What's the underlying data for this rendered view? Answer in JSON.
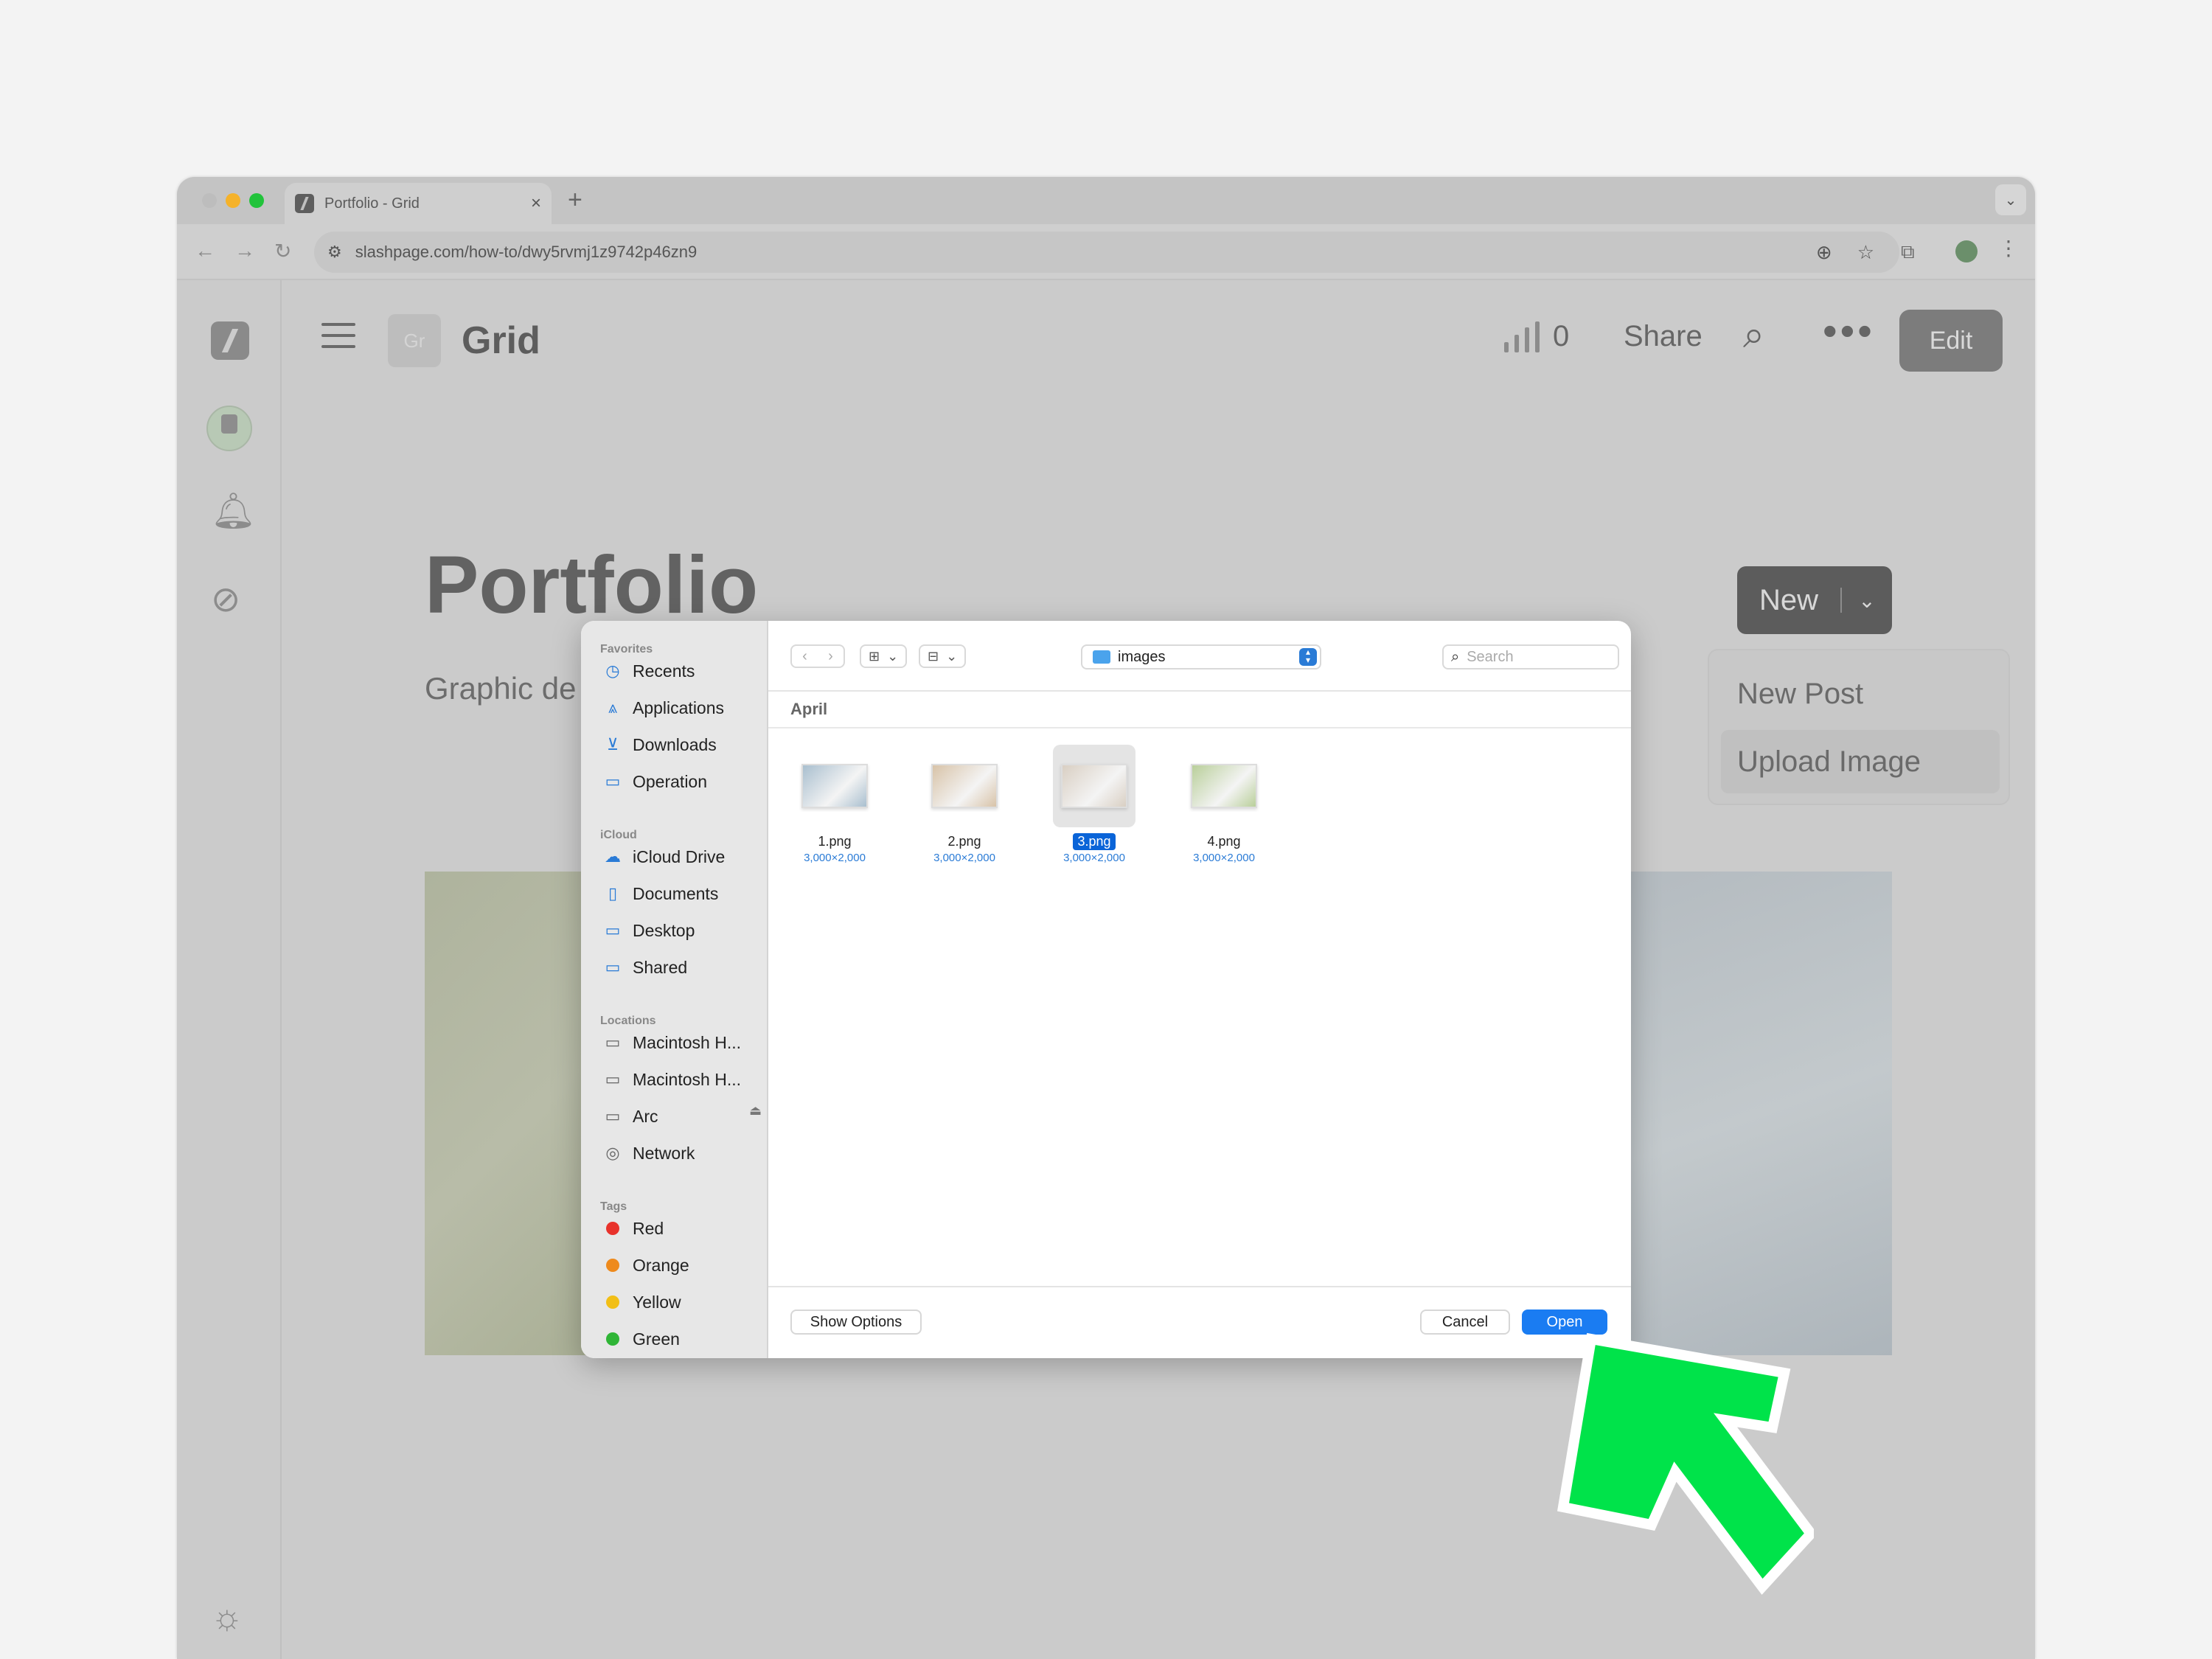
{
  "browser": {
    "tab_title": "Portfolio - Grid",
    "tab_close": "×",
    "new_tab": "+",
    "url": "slashpage.com/how-to/dwy5rvmj1z9742p46zn9"
  },
  "header": {
    "space_badge": "Gr",
    "space_title": "Grid",
    "stats_count": "0",
    "share": "Share",
    "edit": "Edit"
  },
  "page": {
    "heading": "Portfolio",
    "subtitle": "Graphic de",
    "new_button": "New",
    "new_menu": [
      "New Post",
      "Upload Image"
    ]
  },
  "dialog": {
    "sidebar": {
      "favorites_label": "Favorites",
      "favorites": [
        "Recents",
        "Applications",
        "Downloads",
        "Operation"
      ],
      "icloud_label": "iCloud",
      "icloud": [
        "iCloud Drive",
        "Documents",
        "Desktop",
        "Shared"
      ],
      "locations_label": "Locations",
      "locations": [
        "Macintosh H...",
        "Macintosh H...",
        "Arc",
        "Network"
      ],
      "tags_label": "Tags",
      "tags": [
        {
          "name": "Red",
          "color": "#e8322b"
        },
        {
          "name": "Orange",
          "color": "#ee8a1c"
        },
        {
          "name": "Yellow",
          "color": "#f2bf16"
        },
        {
          "name": "Green",
          "color": "#2fb536"
        }
      ]
    },
    "toolbar": {
      "location": "images",
      "search_placeholder": "Search"
    },
    "group": "April",
    "files": [
      {
        "name": "1.png",
        "dims": "3,000×2,000",
        "color": "#a9bfcf"
      },
      {
        "name": "2.png",
        "dims": "3,000×2,000",
        "color": "#d8c3a8"
      },
      {
        "name": "3.png",
        "dims": "3,000×2,000",
        "color": "#d9cfc3"
      },
      {
        "name": "4.png",
        "dims": "3,000×2,000",
        "color": "#b9cf9a"
      }
    ],
    "footer": {
      "show_options": "Show Options",
      "cancel": "Cancel",
      "open": "Open"
    }
  },
  "colors": {
    "accent": "#1a7cf2",
    "arrow": "#00e34a"
  }
}
